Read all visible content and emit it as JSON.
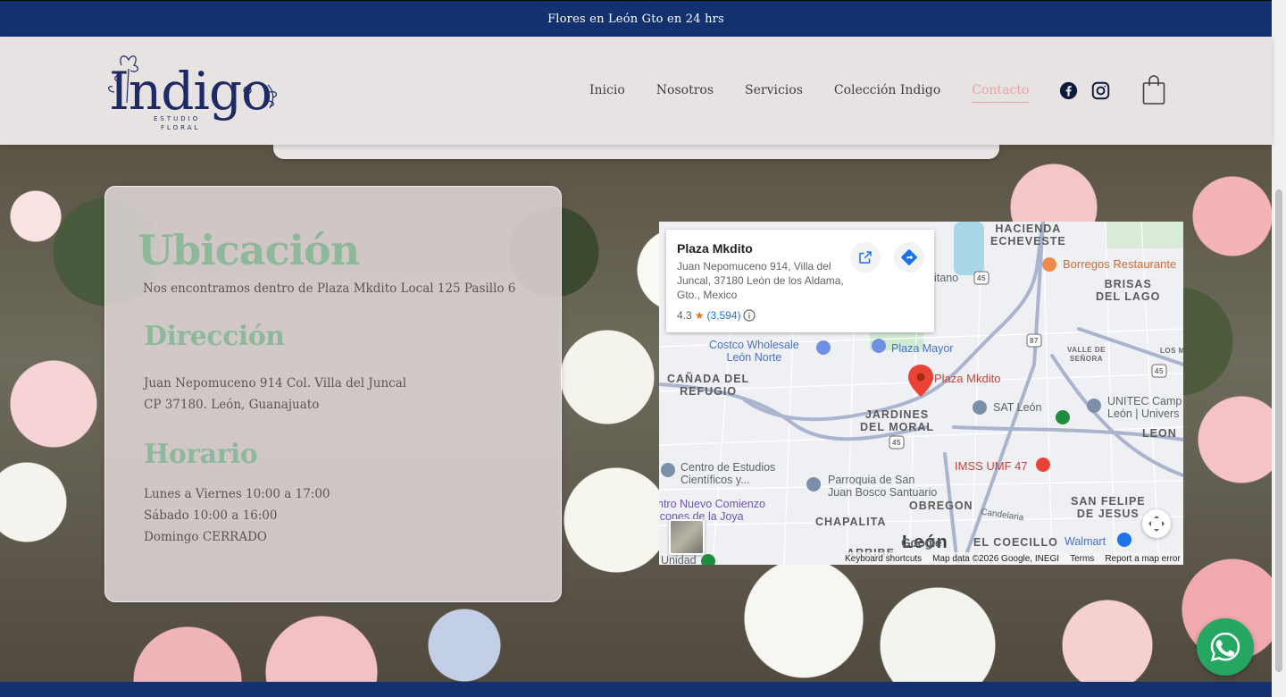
{
  "topbar": {
    "text": "Flores en León Gto en 24 hrs"
  },
  "logo": {
    "word": "Indigo",
    "sub1": "ESTUDIO",
    "sub2": "FLORAL"
  },
  "nav": [
    {
      "label": "Inicio",
      "active": false
    },
    {
      "label": "Nosotros",
      "active": false
    },
    {
      "label": "Servicios",
      "active": false
    },
    {
      "label": "Colección Indigo",
      "active": false
    },
    {
      "label": "Contacto",
      "active": true
    }
  ],
  "social": [
    "facebook-icon",
    "instagram-icon"
  ],
  "info": {
    "title": "Ubicación",
    "location_text": "Nos encontramos dentro de Plaza Mkdito Local 125 Pasillo 6",
    "address_heading": "Dirección",
    "address_lines": [
      "Juan Nepomuceno 914 Col. Villa del Juncal",
      "CP 37180. León, Guanajuato"
    ],
    "hours_heading": "Horario",
    "hours_lines": [
      "Lunes a Viernes 10:00 a 17:00",
      "Sábado 10:00 a 16:00",
      "Domingo CERRADO"
    ]
  },
  "map": {
    "place_name": "Plaza Mkdito",
    "place_address": "Juan Nepomuceno 914, Villa del Juncal, 37180 León de los Aldama, Gto., Mexico",
    "rating": "4.3",
    "review_count": "(3,594)",
    "pin_label": "Plaza Mkdito",
    "labels": {
      "hacienda": "HACIENDA\nECHEVESTE",
      "borregos": "Borregos Restaurante",
      "brisas": "BRISAS\nDEL LAGO",
      "costco": "Costco Wholesale\nLeón Norte",
      "plaza_mayor": "Plaza Mayor",
      "valle": "VALLE DE\nSEÑORA",
      "los_ma": "LOS MA",
      "canada": "CAÑADA DEL\nREFUGIO",
      "jardines": "JARDINES\nDEL MORAL",
      "sat": "SAT León",
      "unitec": "UNITEC Camp\nLeón | Univers",
      "leon": "LEON",
      "centro_estudios": "Centro de Estudios\nCientíficos y...",
      "parroquia": "Parroquia de San\nJuan Bosco Santuario",
      "imss": "IMSS UMF 47",
      "nuevo": "ntro Nuevo Comienzo\nicones de la Joya",
      "chapalita": "CHAPALITA",
      "obregon": "OBREGON",
      "candelaria": "Candelaria",
      "san_felipe": "SAN FELIPE\nDE JESUS",
      "coecillo": "EL COECILLO",
      "walmart": "Walmart",
      "arribe": "ARRIBE",
      "leon_big": "León",
      "unidad": "Unidad",
      "itano": "itano",
      "hw45a": "45",
      "hw45b": "45",
      "hw45c": "45",
      "hw87": "87"
    },
    "footer": [
      "Keyboard shortcuts",
      "Map data ©2026 Google, INEGI",
      "Terms",
      "Report a map error"
    ],
    "google": "Google"
  },
  "colors": {
    "navy": "#13306f",
    "green": "#8db99a",
    "pink_active": "#e9a3a3",
    "whatsapp": "#25a661"
  }
}
